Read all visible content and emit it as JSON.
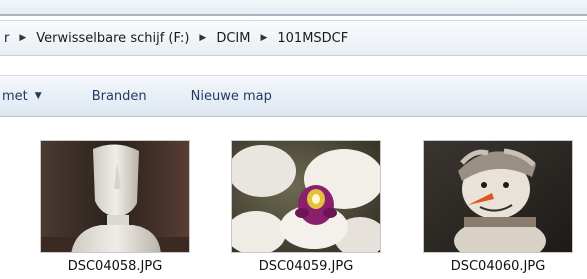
{
  "breadcrumb": {
    "items": [
      "r",
      "Verwisselbare schijf (F:)",
      "DCIM",
      "101MSDCF"
    ],
    "separator_icon": "chevron-right-icon"
  },
  "toolbar": {
    "organize_label": "met",
    "burn_label": "Branden",
    "new_folder_label": "Nieuwe map"
  },
  "files": [
    {
      "name": "DSC04058.JPG",
      "thumbnail": "bust-sculpture-photo"
    },
    {
      "name": "DSC04059.JPG",
      "thumbnail": "orchid-flower-photo"
    },
    {
      "name": "DSC04060.JPG",
      "thumbnail": "snowman-figurine-photo"
    }
  ]
}
